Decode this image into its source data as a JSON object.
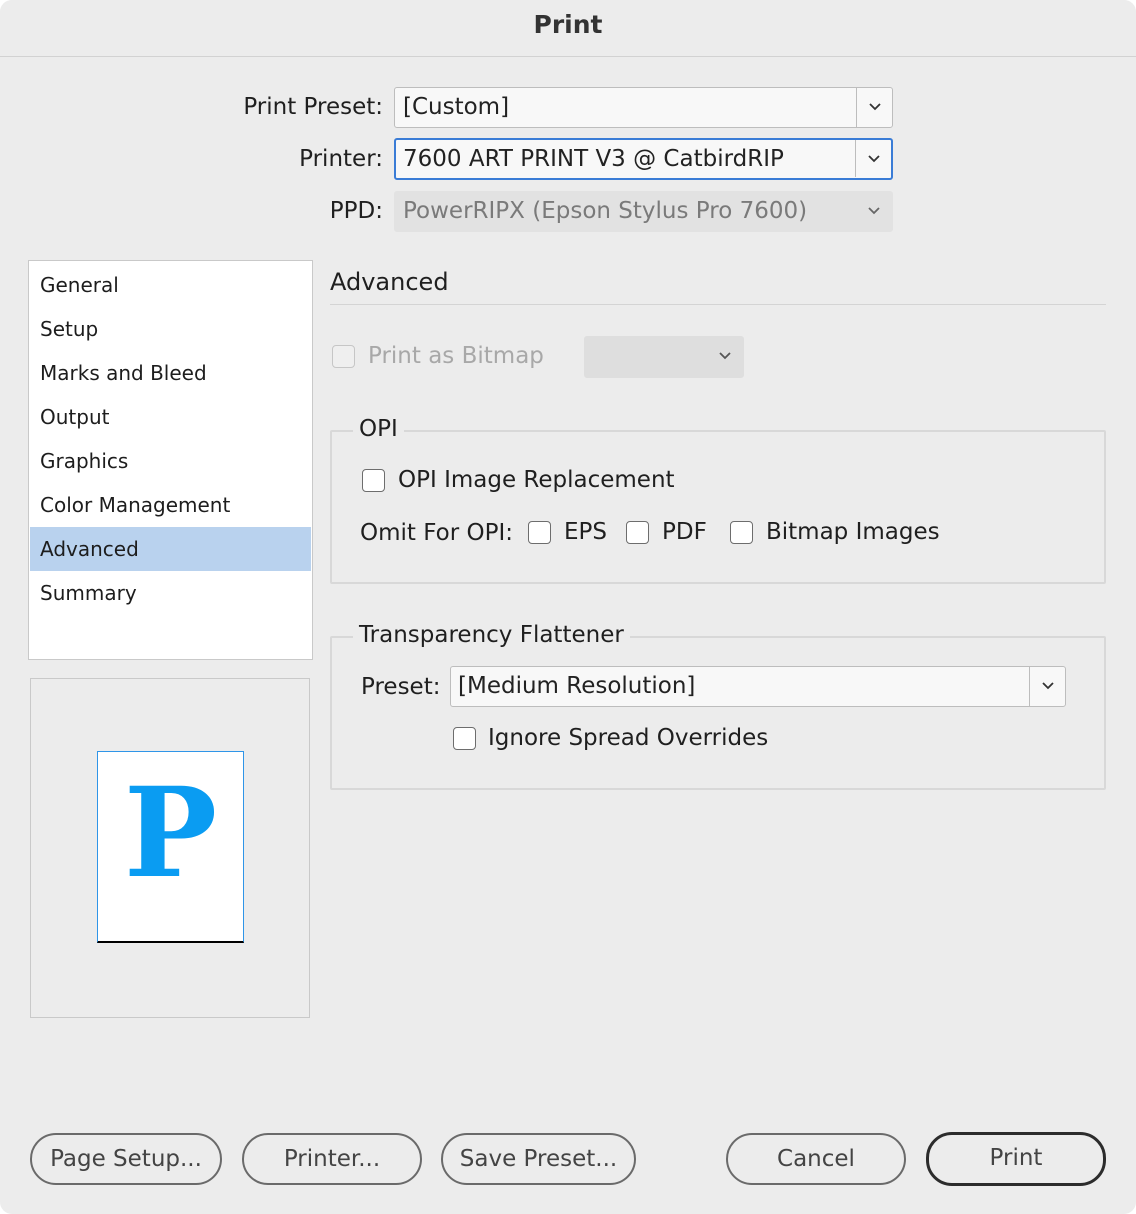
{
  "window": {
    "title": "Print"
  },
  "header": {
    "print_preset": {
      "label": "Print Preset:",
      "value": "[Custom]"
    },
    "printer": {
      "label": "Printer:",
      "value": "7600 ART PRINT V3 @ CatbirdRIP"
    },
    "ppd": {
      "label": "PPD:",
      "value": "PowerRIPX (Epson Stylus Pro 7600)"
    }
  },
  "sidebar": {
    "items": [
      {
        "label": "General"
      },
      {
        "label": "Setup"
      },
      {
        "label": "Marks and Bleed"
      },
      {
        "label": "Output"
      },
      {
        "label": "Graphics"
      },
      {
        "label": "Color Management"
      },
      {
        "label": "Advanced",
        "selected": true
      },
      {
        "label": "Summary"
      }
    ]
  },
  "preview": {
    "letter": "P",
    "accent": "#0a9cf2"
  },
  "main": {
    "section_title": "Advanced",
    "print_as_bitmap": {
      "label": "Print as Bitmap",
      "checked": false,
      "disabled": true,
      "select_value": ""
    },
    "opi": {
      "legend": "OPI",
      "image_replacement": {
        "label": "OPI Image Replacement",
        "checked": false
      },
      "omit_label": "Omit For OPI:",
      "omit": [
        {
          "label": "EPS",
          "checked": false
        },
        {
          "label": "PDF",
          "checked": false
        },
        {
          "label": "Bitmap Images",
          "checked": false
        }
      ]
    },
    "flattener": {
      "legend": "Transparency Flattener",
      "preset_label": "Preset:",
      "preset_value": "[Medium Resolution]",
      "ignore_overrides": {
        "label": "Ignore Spread Overrides",
        "checked": false
      }
    }
  },
  "footer": {
    "page_setup": "Page Setup...",
    "printer": "Printer...",
    "save_preset": "Save Preset...",
    "cancel": "Cancel",
    "print": "Print"
  },
  "colors": {
    "selection": "#b9d2ee",
    "focus": "#3a7cd6",
    "background": "#ececec"
  }
}
